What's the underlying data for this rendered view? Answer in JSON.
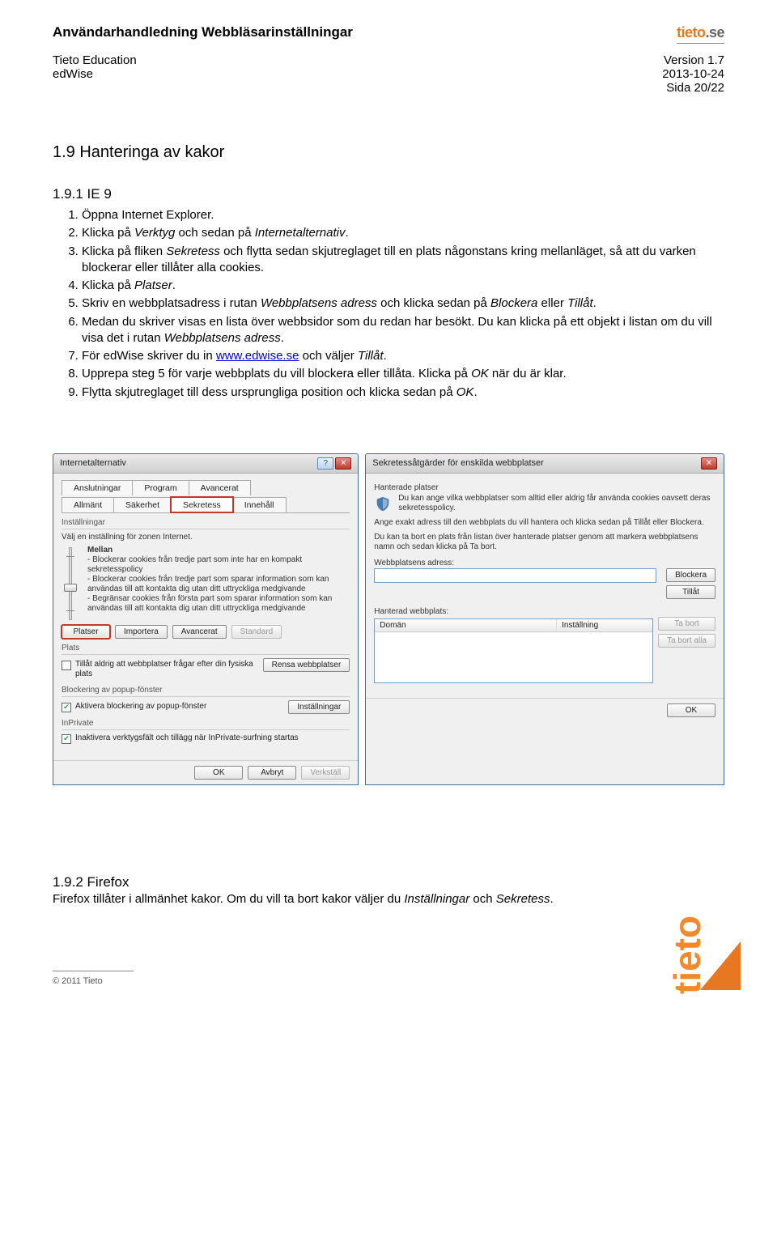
{
  "header": {
    "title": "Användarhandledning Webbläsarinställningar",
    "org": "Tieto Education",
    "product": "edWise",
    "version": "Version 1.7",
    "date": "2013-10-24",
    "page": "Sida 20/22",
    "logo_brand": "tieto",
    "logo_tld": ".se"
  },
  "section_h2": "1.9 Hanteringa av kakor",
  "section_h3": "1.9.1 IE 9",
  "steps": {
    "s1": "Öppna Internet Explorer.",
    "s2_a": "Klicka på ",
    "s2_b": "Verktyg",
    "s2_c": " och sedan på ",
    "s2_d": "Internetalternativ",
    "s2_e": ".",
    "s3_a": "Klicka på fliken ",
    "s3_b": "Sekretess",
    "s3_c": " och flytta sedan skjutreglaget till en plats någonstans kring mellanläget, så att du varken blockerar eller tillåter alla cookies.",
    "s4_a": "Klicka på ",
    "s4_b": "Platser",
    "s4_c": ".",
    "s5_a": "Skriv en webbplatsadress i rutan ",
    "s5_b": "Webbplatsens adress",
    "s5_c": " och klicka sedan på ",
    "s5_d": "Blockera",
    "s5_e": " eller ",
    "s5_f": "Tillåt",
    "s5_g": ".",
    "s6_a": "Medan du skriver visas en lista över webbsidor som du redan har besökt. Du kan klicka på ett objekt i listan om du vill visa det i rutan ",
    "s6_b": "Webbplatsens adress",
    "s6_c": ".",
    "s7_a": "För edWise skriver du in ",
    "s7_link": "www.edwise.se",
    "s7_b": " och väljer ",
    "s7_c": "Tillåt",
    "s7_d": ".",
    "s8_a": "Upprepa steg 5 för varje webbplats du vill blockera eller tillåta. Klicka på ",
    "s8_b": "OK",
    "s8_c": " när du är klar.",
    "s9_a": "Flytta skjutreglaget till dess ursprungliga position och klicka sedan på ",
    "s9_b": "OK",
    "s9_c": "."
  },
  "dlg1": {
    "title": "Internetalternativ",
    "tabs_row1": [
      "Anslutningar",
      "Program",
      "Avancerat"
    ],
    "tabs_row2": [
      "Allmänt",
      "Säkerhet",
      "Sekretess",
      "Innehåll"
    ],
    "sec_settings": "Inställningar",
    "zone_text": "Välj en inställning för zonen Internet.",
    "level": "Mellan",
    "bullets": [
      "- Blockerar cookies från tredje part som inte har en kompakt sekretesspolicy",
      "- Blockerar cookies från tredje part som sparar information som kan användas till att kontakta dig utan ditt uttryckliga medgivande",
      "- Begränsar cookies från första part som sparar information som kan användas till att kontakta dig utan ditt uttryckliga medgivande"
    ],
    "btn_platser": "Platser",
    "btn_importera": "Importera",
    "btn_avancerat": "Avancerat",
    "btn_standard": "Standard",
    "sec_plats": "Plats",
    "chk_plats": "Tillåt aldrig att webbplatser frågar efter din fysiska plats",
    "btn_rensa": "Rensa webbplatser",
    "sec_popup": "Blockering av popup-fönster",
    "chk_popup": "Aktivera blockering av popup-fönster",
    "btn_popup_settings": "Inställningar",
    "sec_inprivate": "InPrivate",
    "chk_inprivate": "Inaktivera verktygsfält och tillägg när InPrivate-surfning startas",
    "btn_ok": "OK",
    "btn_avbryt": "Avbryt",
    "btn_verkstall": "Verkställ"
  },
  "dlg2": {
    "title": "Sekretessåtgärder för enskilda webbplatser",
    "heading": "Hanterade platser",
    "intro": "Du kan ange vilka webbplatser som alltid eller aldrig får använda cookies oavsett deras sekretesspolicy.",
    "para1": "Ange exakt adress till den webbplats du vill hantera och klicka sedan på Tillåt eller Blockera.",
    "para2": "Du kan ta bort en plats från listan över hanterade platser genom att markera webbplatsens namn och sedan klicka på Ta bort.",
    "lbl_addr": "Webbplatsens adress:",
    "btn_blockera": "Blockera",
    "btn_tillat": "Tillåt",
    "lbl_managed": "Hanterad webbplats:",
    "col_domain": "Domän",
    "col_setting": "Inställning",
    "btn_tabort": "Ta bort",
    "btn_tabort_alla": "Ta bort alla",
    "btn_ok": "OK"
  },
  "firefox": {
    "h3": "1.9.2 Firefox",
    "text_a": "Firefox tillåter i allmänhet kakor. Om du vill ta bort kakor väljer du ",
    "text_b": "Inställningar",
    "text_c": " och ",
    "text_d": "Sekretess",
    "text_e": "."
  },
  "footer": {
    "copyright": "© 2011 Tieto"
  }
}
